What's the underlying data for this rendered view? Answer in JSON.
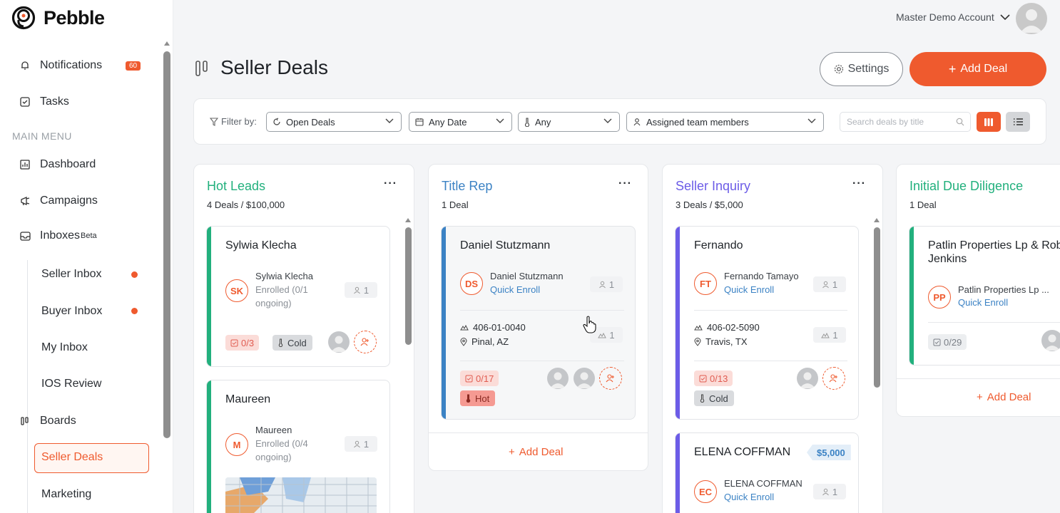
{
  "app": {
    "name": "Pebble"
  },
  "sidebar": {
    "notifications": {
      "label": "Notifications",
      "badge": "60"
    },
    "tasks": "Tasks",
    "section": "MAIN MENU",
    "dashboard": "Dashboard",
    "campaigns": "Campaigns",
    "inboxes": {
      "label": "Inboxes",
      "tag": "Beta"
    },
    "inbox_items": [
      "Seller Inbox",
      "Buyer Inbox",
      "My Inbox",
      "IOS Review"
    ],
    "boards": "Boards",
    "board_items": [
      "Seller Deals",
      "Marketing"
    ]
  },
  "header": {
    "account": "Master Demo Account"
  },
  "page": {
    "title": "Seller Deals",
    "settings_label": "Settings",
    "add_deal_label": "Add Deal"
  },
  "filters": {
    "label": "Filter by:",
    "status": "Open Deals",
    "date": "Any Date",
    "temperature": "Any",
    "members": "Assigned team members",
    "search_placeholder": "Search deals by title"
  },
  "columns": [
    {
      "title": "Hot Leads",
      "summary": "4 Deals / $100,000",
      "color": "#22b07d",
      "cards": [
        {
          "name": "Sylwia Klecha",
          "initials": "SK",
          "contact": "Sylwia Klecha",
          "status_1": "Enrolled (0/1",
          "status_2": "ongoing)",
          "count": "1",
          "tasks": "0/3",
          "temp": "Cold"
        },
        {
          "name": "Maureen",
          "initials": "M",
          "contact": "Maureen",
          "status_1": "Enrolled (0/4",
          "status_2": "ongoing)",
          "count": "1"
        }
      ]
    },
    {
      "title": "Title Rep",
      "summary": "1 Deal",
      "color": "#3b82c4",
      "cards": [
        {
          "name": "Daniel Stutzmann",
          "initials": "DS",
          "contact": "Daniel Stutzmann",
          "link": "Quick Enroll",
          "count": "1",
          "parcel": "406-01-0040",
          "location": "Pinal, AZ",
          "parcel_count": "1",
          "tasks": "0/17",
          "temp": "Hot"
        }
      ],
      "add_label": "Add Deal"
    },
    {
      "title": "Seller Inquiry",
      "summary": "3 Deals / $5,000",
      "color": "#6c5ce7",
      "cards": [
        {
          "name": "Fernando",
          "initials": "FT",
          "contact": "Fernando Tamayo",
          "link": "Quick Enroll",
          "count": "1",
          "parcel": "406-02-5090",
          "location": "Travis, TX",
          "parcel_count": "1",
          "tasks": "0/13",
          "temp": "Cold"
        },
        {
          "name": "ELENA COFFMAN",
          "initials": "EC",
          "contact": "ELENA COFFMAN",
          "link": "Quick Enroll",
          "count": "1",
          "price": "$5,000"
        }
      ]
    },
    {
      "title": "Initial Due Diligence",
      "summary": "1 Deal",
      "color": "#22b07d",
      "cards": [
        {
          "name_1": "Patlin Properties Lp & Rob",
          "name_2": "Jenkins",
          "initials": "PP",
          "contact": "Patlin Properties Lp ...",
          "link": "Quick Enroll",
          "tasks": "0/29"
        }
      ],
      "add_label": "Add Deal"
    }
  ]
}
